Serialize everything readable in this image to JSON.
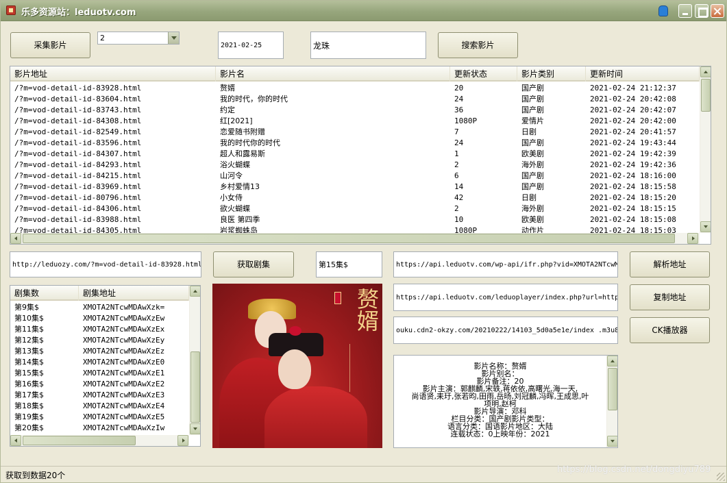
{
  "window": {
    "title": "乐多资源站：leduotv.com"
  },
  "toolbar": {
    "collect_label": "采集影片",
    "page_value": "2",
    "date_value": "2021-02-25",
    "search_value": "龙珠",
    "search_label": "搜索影片"
  },
  "movie_list": {
    "columns": [
      "影片地址",
      "影片名",
      "更新状态",
      "影片类别",
      "更新时间"
    ],
    "rows": [
      [
        "/?m=vod-detail-id-83928.html",
        "赘婿",
        "20",
        "国产剧",
        "2021-02-24 21:12:37"
      ],
      [
        "/?m=vod-detail-id-83604.html",
        "我的时代，你的时代",
        "24",
        "国产剧",
        "2021-02-24 20:42:08"
      ],
      [
        "/?m=vod-detail-id-83743.html",
        "约定",
        "36",
        "国产剧",
        "2021-02-24 20:42:07"
      ],
      [
        "/?m=vod-detail-id-84308.html",
        "红[2021]",
        "1080P",
        "爱情片",
        "2021-02-24 20:42:00"
      ],
      [
        "/?m=vod-detail-id-82549.html",
        "恋爱随书附赠",
        "7",
        "日剧",
        "2021-02-24 20:41:57"
      ],
      [
        "/?m=vod-detail-id-83596.html",
        "我的时代你的时代",
        "24",
        "国产剧",
        "2021-02-24 19:43:44"
      ],
      [
        "/?m=vod-detail-id-84307.html",
        "超人和露易斯",
        "1",
        "欧美剧",
        "2021-02-24 19:42:39"
      ],
      [
        "/?m=vod-detail-id-84293.html",
        "浴火蝴蝶",
        "2",
        "海外剧",
        "2021-02-24 19:42:36"
      ],
      [
        "/?m=vod-detail-id-84215.html",
        "山河令",
        "6",
        "国产剧",
        "2021-02-24 18:16:00"
      ],
      [
        "/?m=vod-detail-id-83969.html",
        "乡村爱情13",
        "14",
        "国产剧",
        "2021-02-24 18:15:58"
      ],
      [
        "/?m=vod-detail-id-80796.html",
        "小女侍",
        "42",
        "日剧",
        "2021-02-24 18:15:20"
      ],
      [
        "/?m=vod-detail-id-84306.html",
        "欲火蝴蝶",
        "2",
        "海外剧",
        "2021-02-24 18:15:15"
      ],
      [
        "/?m=vod-detail-id-83988.html",
        "良医 第四季",
        "10",
        "欧美剧",
        "2021-02-24 18:15:08"
      ],
      [
        "/?m=vod-detail-id-84305.html",
        "岩浆蜘蛛岛",
        "1080P",
        "动作片",
        "2021-02-24 18:15:03"
      ]
    ]
  },
  "detail": {
    "url_value": "http://leduozy.com/?m=vod-detail-id-83928.html",
    "get_episodes_label": "获取剧集",
    "episode_value": "第15集$",
    "api_url_1": "https://api.leduotv.com/wp-api/ifr.php?vid=XMOTA2NTcwM",
    "api_url_2": "https://api.leduotv.com/leduoplayer/index.php?url=http",
    "m3u8_url": "ouku.cdn2-okzy.com/20210222/14103_5d0a5e1e/index .m3u8",
    "parse_label": "解析地址",
    "copy_label": "复制地址",
    "ck_label": "CK播放器"
  },
  "episode_list": {
    "columns": [
      "剧集数",
      "剧集地址"
    ],
    "rows": [
      [
        "第9集$",
        "XMOTA2NTcwMDAwXzk="
      ],
      [
        "第10集$",
        "XMOTA2NTcwMDAwXzEw"
      ],
      [
        "第11集$",
        "XMOTA2NTcwMDAwXzEx"
      ],
      [
        "第12集$",
        "XMOTA2NTcwMDAwXzEy"
      ],
      [
        "第13集$",
        "XMOTA2NTcwMDAwXzEz"
      ],
      [
        "第14集$",
        "XMOTA2NTcwMDAwXzE0"
      ],
      [
        "第15集$",
        "XMOTA2NTcwMDAwXzE1"
      ],
      [
        "第16集$",
        "XMOTA2NTcwMDAwXzE2"
      ],
      [
        "第17集$",
        "XMOTA2NTcwMDAwXzE3"
      ],
      [
        "第18集$",
        "XMOTA2NTcwMDAwXzE4"
      ],
      [
        "第19集$",
        "XMOTA2NTcwMDAwXzE5"
      ],
      [
        "第20集$",
        "XMOTA2NTcwMDAwXzIw"
      ]
    ]
  },
  "poster": {
    "title": "赘婿",
    "poster_color": "#a51d1f"
  },
  "info": {
    "lines": [
      "影片名称：赘婿",
      "影片别名：",
      "影片备注：20",
      "影片主演：郭麒麟,宋轶,蒋依依,高曙光,海一天,",
      "尚语贤,耒玗,张若昀,田雨,岳旸,刘冠麟,冯晖,王成思,叶",
      "项明,赵柯",
      "影片导演：邓科",
      "栏目分类：国产剧影片类型：",
      "语言分类：国语影片地区：大陆",
      "连载状态：0上映年份：2021"
    ]
  },
  "status": {
    "text": "获取到数据20个",
    "watermark": "https://blog.csdn.net/dongdiyu789"
  }
}
